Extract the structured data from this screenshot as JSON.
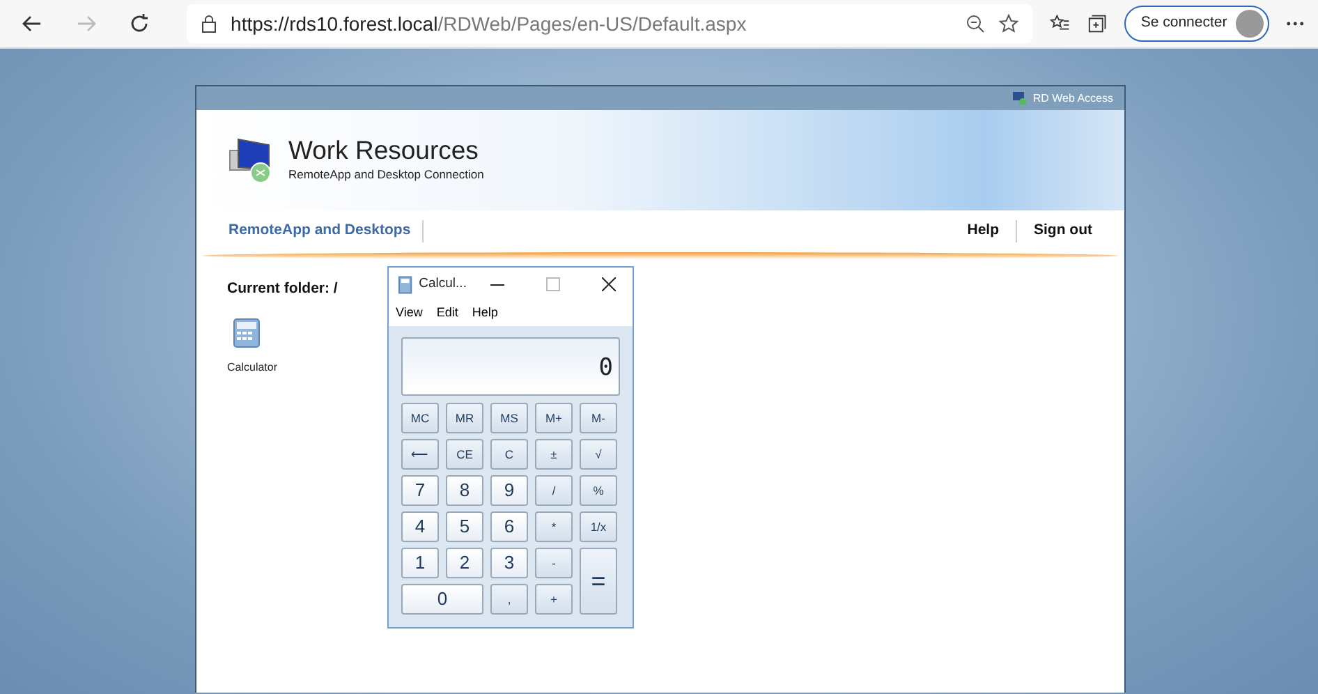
{
  "browser": {
    "back_disabled": false,
    "forward_disabled": true,
    "url_host": "https://rds10.forest.local",
    "url_path": "/RDWeb/Pages/en-US/Default.aspx",
    "sign_in": "Se connecter"
  },
  "page": {
    "top_bar": "RD Web Access",
    "title": "Work Resources",
    "subtitle": "RemoteApp and Desktop Connection",
    "tabs": [
      {
        "label": "RemoteApp and Desktops",
        "selected": true
      }
    ],
    "links": [
      "Help",
      "Sign out"
    ],
    "current_folder": "Current folder: /",
    "apps": [
      {
        "label": "Calculator"
      }
    ]
  },
  "calculator": {
    "title": "Calcul...",
    "menu": [
      "View",
      "Edit",
      "Help"
    ],
    "display": "0",
    "buttons": [
      {
        "label": "MC",
        "kind": "op"
      },
      {
        "label": "MR",
        "kind": "op"
      },
      {
        "label": "MS",
        "kind": "op"
      },
      {
        "label": "M+",
        "kind": "op"
      },
      {
        "label": "M-",
        "kind": "op"
      },
      {
        "label": "⟵",
        "kind": "op"
      },
      {
        "label": "CE",
        "kind": "op"
      },
      {
        "label": "C",
        "kind": "op"
      },
      {
        "label": "±",
        "kind": "op"
      },
      {
        "label": "√",
        "kind": "op"
      },
      {
        "label": "7",
        "kind": "digit"
      },
      {
        "label": "8",
        "kind": "digit"
      },
      {
        "label": "9",
        "kind": "digit"
      },
      {
        "label": "/",
        "kind": "op"
      },
      {
        "label": "%",
        "kind": "op"
      },
      {
        "label": "4",
        "kind": "digit"
      },
      {
        "label": "5",
        "kind": "digit"
      },
      {
        "label": "6",
        "kind": "digit"
      },
      {
        "label": "*",
        "kind": "op"
      },
      {
        "label": "1/x",
        "kind": "op"
      },
      {
        "label": "1",
        "kind": "digit"
      },
      {
        "label": "2",
        "kind": "digit"
      },
      {
        "label": "3",
        "kind": "digit"
      },
      {
        "label": "-",
        "kind": "op"
      },
      {
        "label": "=",
        "kind": "tall"
      },
      {
        "label": "0",
        "kind": "wide"
      },
      {
        "label": ",",
        "kind": "op"
      },
      {
        "label": "+",
        "kind": "op"
      }
    ]
  }
}
